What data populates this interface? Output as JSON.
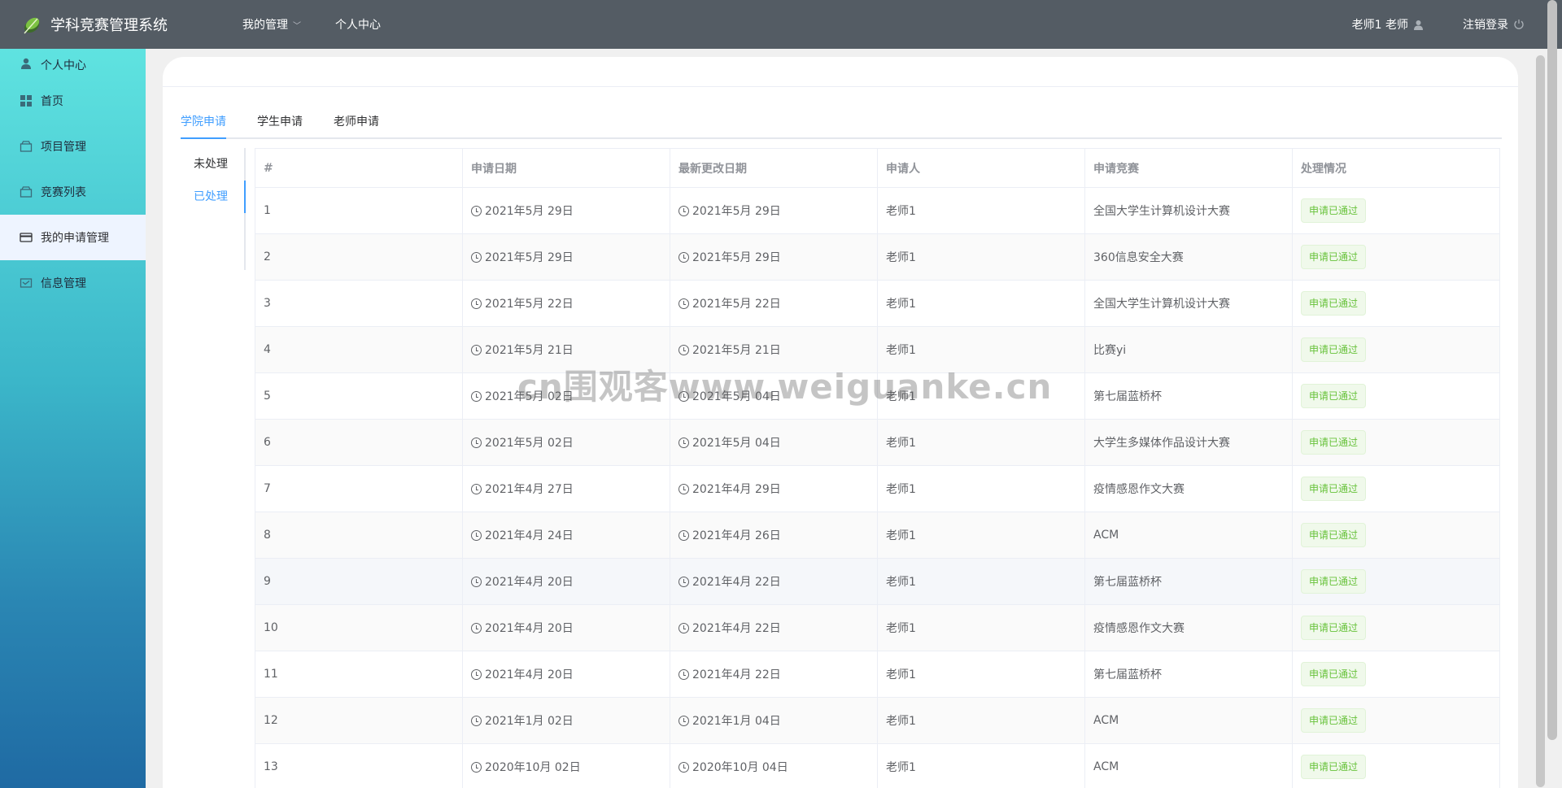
{
  "header": {
    "title": "学科竞赛管理系统",
    "nav": [
      {
        "label": "我的管理",
        "has_dropdown": true
      },
      {
        "label": "个人中心",
        "has_dropdown": false
      }
    ],
    "user_label": "老师1 老师",
    "logout_label": "注销登录"
  },
  "sidebar": {
    "items": [
      {
        "label": "个人中心",
        "icon": "user-icon"
      },
      {
        "label": "首页",
        "icon": "grid-icon"
      },
      {
        "label": "项目管理",
        "icon": "box-icon"
      },
      {
        "label": "竞赛列表",
        "icon": "box-icon"
      },
      {
        "label": "我的申请管理",
        "icon": "card-icon",
        "active": true
      },
      {
        "label": "信息管理",
        "icon": "message-icon"
      }
    ]
  },
  "tabs": [
    "学院申请",
    "学生申请",
    "老师申请"
  ],
  "vtabs": [
    "未处理",
    "已处理"
  ],
  "table": {
    "headers": [
      "#",
      "申请日期",
      "最新更改日期",
      "申请人",
      "申请竞赛",
      "处理情况"
    ],
    "rows": [
      [
        "1",
        "2021年5月 29日",
        "2021年5月 29日",
        "老师1",
        "全国大学生计算机设计大赛",
        "申请已通过"
      ],
      [
        "2",
        "2021年5月 29日",
        "2021年5月 29日",
        "老师1",
        "360信息安全大赛",
        "申请已通过"
      ],
      [
        "3",
        "2021年5月 22日",
        "2021年5月 22日",
        "老师1",
        "全国大学生计算机设计大赛",
        "申请已通过"
      ],
      [
        "4",
        "2021年5月 21日",
        "2021年5月 21日",
        "老师1",
        "比赛yi",
        "申请已通过"
      ],
      [
        "5",
        "2021年5月 02日",
        "2021年5月 04日",
        "老师1",
        "第七届蓝桥杯",
        "申请已通过"
      ],
      [
        "6",
        "2021年5月 02日",
        "2021年5月 04日",
        "老师1",
        "大学生多媒体作品设计大赛",
        "申请已通过"
      ],
      [
        "7",
        "2021年4月 27日",
        "2021年4月 29日",
        "老师1",
        "疫情感恩作文大赛",
        "申请已通过"
      ],
      [
        "8",
        "2021年4月 24日",
        "2021年4月 26日",
        "老师1",
        "ACM",
        "申请已通过"
      ],
      [
        "9",
        "2021年4月 20日",
        "2021年4月 22日",
        "老师1",
        "第七届蓝桥杯",
        "申请已通过"
      ],
      [
        "10",
        "2021年4月 20日",
        "2021年4月 22日",
        "老师1",
        "疫情感恩作文大赛",
        "申请已通过"
      ],
      [
        "11",
        "2021年4月 20日",
        "2021年4月 22日",
        "老师1",
        "第七届蓝桥杯",
        "申请已通过"
      ],
      [
        "12",
        "2021年1月 02日",
        "2021年1月 04日",
        "老师1",
        "ACM",
        "申请已通过"
      ],
      [
        "13",
        "2020年10月 02日",
        "2020年10月 04日",
        "老师1",
        "ACM",
        "申请已通过"
      ]
    ]
  },
  "watermark": "cn围观客www.weiguanke.cn",
  "colors": {
    "topbar": "#545c64",
    "accent": "#409eff",
    "success": "#67c23a"
  }
}
